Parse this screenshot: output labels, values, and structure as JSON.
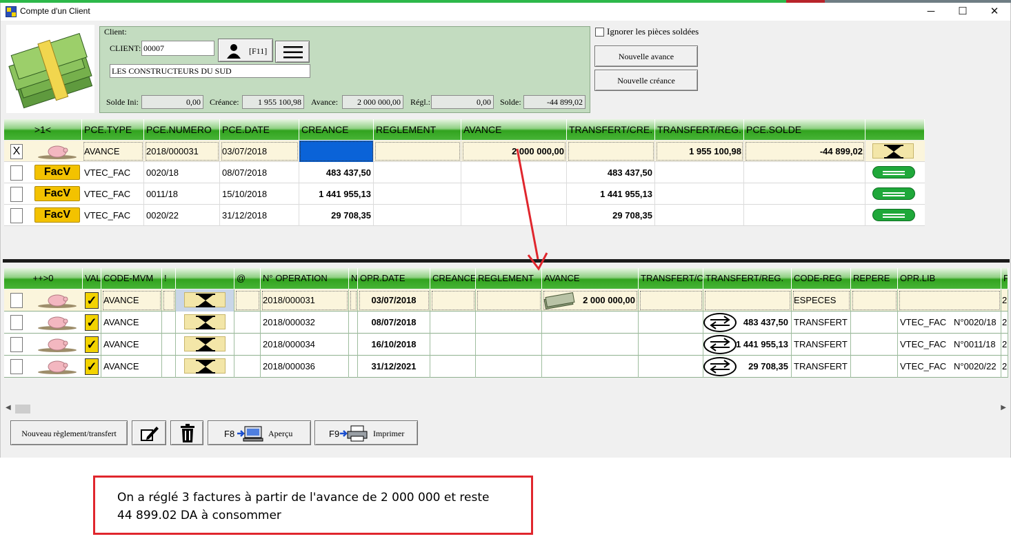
{
  "window": {
    "title": "Compte d'un Client",
    "controls": {
      "minimize": "─",
      "maximize": "☐",
      "close": "✕"
    }
  },
  "client": {
    "group_label": "Client:",
    "code_label": "CLIENT:",
    "code_value": "00007",
    "f11_label": "[F11]",
    "name_value": "LES CONSTRUCTEURS DU SUD",
    "totals": [
      {
        "label": "Solde Ini:",
        "value": "0,00"
      },
      {
        "label": "Créance:",
        "value": "1 955 100,98"
      },
      {
        "label": "Avance:",
        "value": "2 000 000,00"
      },
      {
        "label": "Régl.:",
        "value": "0,00"
      },
      {
        "label": "Solde:",
        "value": "-44 899,02"
      }
    ]
  },
  "options": {
    "ignore_label": "Ignorer les pièces soldées",
    "ignore_checked": false,
    "new_advance_label": "Nouvelle avance",
    "new_debt_label": "Nouvelle créance"
  },
  "pieces": {
    "columns": [
      ">1<",
      "PCE.TYPE",
      "PCE.NUMERO",
      "PCE.DATE",
      "CREANCE",
      "REGLEMENT",
      "AVANCE",
      "TRANSFERT/CRE.",
      "TRANSFERT/REG.",
      "PCE.SOLDE",
      ""
    ],
    "rows": [
      {
        "checked": "X",
        "icon": "piggy-bank-icon",
        "type": "AVANCE",
        "numero": "2018/000031",
        "date": "03/07/2018",
        "creance": "",
        "reglement": "",
        "avance": "2 000 000,00",
        "transfert_cre": "",
        "transfert_reg": "1 955 100,98",
        "solde": "-44 899,02",
        "status_icon": "hourglass-icon"
      },
      {
        "checked": "",
        "icon_label": "FacV",
        "type": "VTEC_FAC",
        "numero": "0020/18",
        "date": "08/07/2018",
        "creance": "483 437,50",
        "reglement": "",
        "avance": "",
        "transfert_cre": "483 437,50",
        "transfert_reg": "",
        "solde": "",
        "status_icon": "equals-pill-icon"
      },
      {
        "checked": "",
        "icon_label": "FacV",
        "type": "VTEC_FAC",
        "numero": "0011/18",
        "date": "15/10/2018",
        "creance": "1 441 955,13",
        "reglement": "",
        "avance": "",
        "transfert_cre": "1 441 955,13",
        "transfert_reg": "",
        "solde": "",
        "status_icon": "equals-pill-icon"
      },
      {
        "checked": "",
        "icon_label": "FacV",
        "type": "VTEC_FAC",
        "numero": "0020/22",
        "date": "31/12/2018",
        "creance": "29 708,35",
        "reglement": "",
        "avance": "",
        "transfert_cre": "29 708,35",
        "transfert_reg": "",
        "solde": "",
        "status_icon": "equals-pill-icon"
      }
    ]
  },
  "operations": {
    "columns": [
      "++>0",
      "VAL",
      "CODE-MVM",
      "!",
      "",
      "@",
      "N° OPERATION",
      "N",
      "OPR.DATE",
      "CREANCE",
      "REGLEMENT",
      "AVANCE",
      "TRANSFERT/CI",
      "TRANSFERT/REG.",
      "CODE-REG",
      "REPERE",
      "OPR.LIB",
      "P"
    ],
    "rows": [
      {
        "code": "AVANCE",
        "numero": "2018/000031",
        "date": "03/07/2018",
        "avance": "2 000 000,00",
        "transfert_reg": "",
        "code_reg": "ESPECES",
        "lib": "",
        "p": "2"
      },
      {
        "code": "AVANCE",
        "numero": "2018/000032",
        "date": "08/07/2018",
        "avance": "",
        "transfert_reg": "483 437,50",
        "code_reg": "TRANSFERT",
        "lib": "VTEC_FAC   N°0020/18",
        "p": "2"
      },
      {
        "code": "AVANCE",
        "numero": "2018/000034",
        "date": "16/10/2018",
        "avance": "",
        "transfert_reg": "1 441 955,13",
        "code_reg": "TRANSFERT",
        "lib": "VTEC_FAC   N°0011/18",
        "p": "2"
      },
      {
        "code": "AVANCE",
        "numero": "2018/000036",
        "date": "31/12/2021",
        "avance": "",
        "transfert_reg": "29 708,35",
        "code_reg": "TRANSFERT",
        "lib": "VTEC_FAC   N°0020/22",
        "p": "2"
      }
    ]
  },
  "toolbar": {
    "new_payment_label": "Nouveau règlement/transfert",
    "preview_key": "F8",
    "preview_label": "Aperçu",
    "print_key": "F9",
    "print_label": "Imprimer"
  },
  "annotation": {
    "text": "On a réglé 3 factures à partir de l'avance de 2 000 000 et reste\n44 899.02  DA à consommer",
    "arrow_color": "#e0262d"
  }
}
